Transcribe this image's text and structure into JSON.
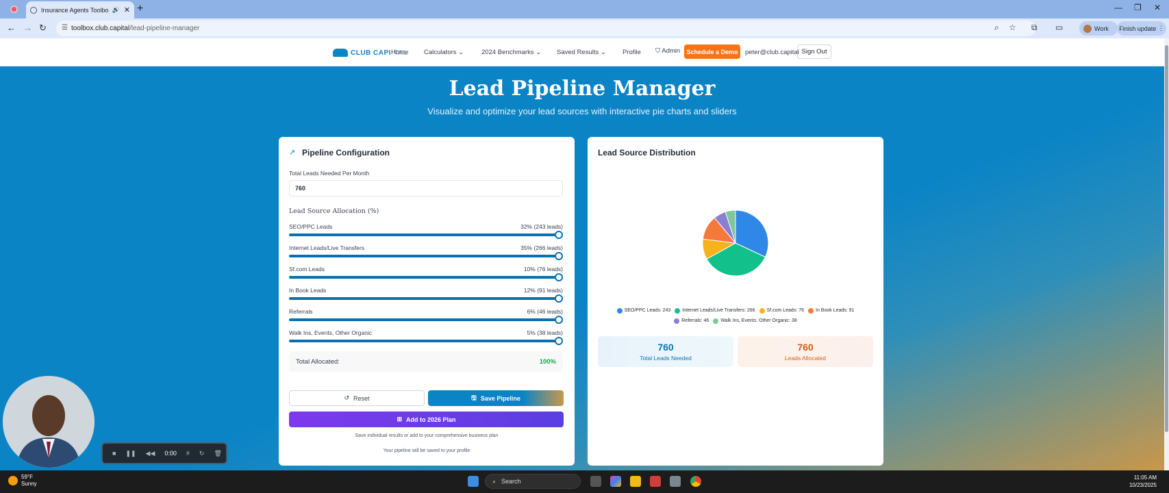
{
  "browser": {
    "tab_title": "Insurance Agents Toolbox",
    "url_host": "toolbox.club.capital",
    "url_path": "/lead-pipeline-manager",
    "profile_label": "Work",
    "finish_update_label": "Finish update"
  },
  "site_nav": {
    "logo_text": "CLUB CAPI",
    "logo_text_fade": "TAL",
    "items": [
      "Home",
      "Calculators",
      "2024 Benchmarks",
      "Saved Results",
      "Profile",
      "Admin"
    ],
    "cta_label": "Schedule a Demo",
    "user_email": "peter@club.capital",
    "signout_label": "Sign Out"
  },
  "hero": {
    "title": "Lead Pipeline Manager",
    "subtitle": "Visualize and optimize your lead sources with interactive pie charts and sliders"
  },
  "config": {
    "title": "Pipeline Configuration",
    "total_leads_label": "Total Leads Needed Per Month",
    "total_leads_value": "760",
    "allocation_title": "Lead Source Allocation (%)",
    "sources": [
      {
        "name": "SEO/PPC Leads",
        "pct_text": "32% (243 leads)",
        "pct": 32
      },
      {
        "name": "Internet Leads/Live Transfers",
        "pct_text": "35% (266 leads)",
        "pct": 35
      },
      {
        "name": "Sf.com Leads",
        "pct_text": "10% (76 leads)",
        "pct": 10
      },
      {
        "name": "In Book Leads",
        "pct_text": "12% (91 leads)",
        "pct": 12
      },
      {
        "name": "Referrals",
        "pct_text": "6% (46 leads)",
        "pct": 6
      },
      {
        "name": "Walk Ins, Events, Other Organic",
        "pct_text": "5% (38 leads)",
        "pct": 5
      }
    ],
    "total_allocated_label": "Total Allocated:",
    "total_allocated_value": "100%",
    "reset_label": "Reset",
    "save_label": "Save Pipeline",
    "add_plan_label": "Add to 2026 Plan",
    "note1": "Save individual results or add to your comprehensive business plan",
    "note2": "Your pipeline will be saved to your profile"
  },
  "distribution": {
    "title": "Lead Source Distribution",
    "legend": [
      "SEO/PPC Leads: 243",
      "Internet Leads/Live Transfers: 266",
      "Sf.com Leads: 76",
      "In Book Leads: 91",
      "Referrals: 46",
      "Walk Ins, Events, Other Organic: 38"
    ],
    "colors": [
      "#2f87e8",
      "#12c08b",
      "#f6b21b",
      "#f4793a",
      "#8b7fd1",
      "#7fc79a"
    ],
    "stat_needed_value": "760",
    "stat_needed_label": "Total Leads Needed",
    "stat_allocated_value": "760",
    "stat_allocated_label": "Leads Allocated"
  },
  "chart_data": {
    "type": "pie",
    "categories": [
      "SEO/PPC Leads",
      "Internet Leads/Live Transfers",
      "Sf.com Leads",
      "In Book Leads",
      "Referrals",
      "Walk Ins, Events, Other Organic"
    ],
    "values": [
      243,
      266,
      76,
      91,
      46,
      38
    ],
    "title": "Lead Source Distribution",
    "legend": "bottom"
  },
  "recorder": {
    "time": "0:00"
  },
  "taskbar": {
    "temp": "59°F",
    "condition": "Sunny",
    "search_label": "Search",
    "time": "11:05 AM",
    "date": "10/23/2025"
  }
}
